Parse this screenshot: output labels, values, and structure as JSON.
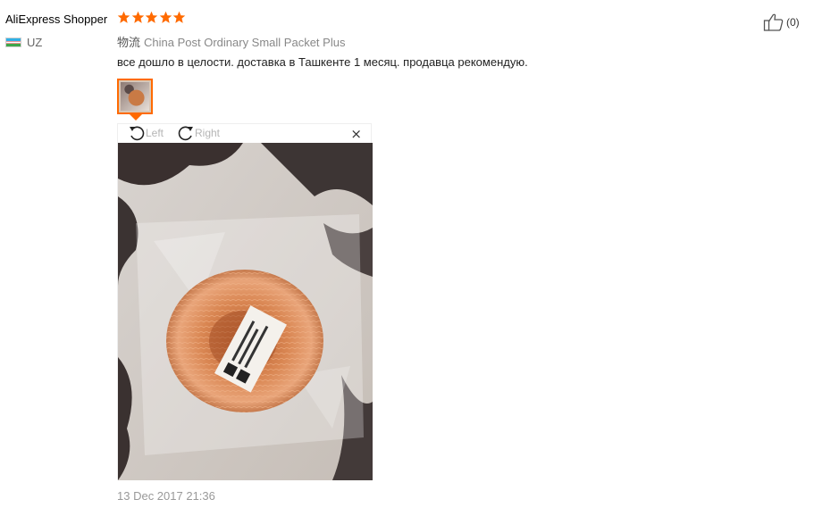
{
  "user": {
    "name": "AliExpress Shopper",
    "country": "UZ"
  },
  "review": {
    "rating": 5,
    "star_color": "#ff6a00",
    "shipping_label": "物流",
    "shipping_method": "China Post Ordinary Small Packet Plus",
    "text": "все дошло в целости. доставка в Ташкенте 1 месяц. продавца рекомендую.",
    "date": "13 Dec 2017 21:36"
  },
  "viewer": {
    "rotate_left_label": "Left",
    "rotate_right_label": "Right",
    "close_glyph": "×"
  },
  "helpful": {
    "count": "(0)",
    "icon": "thumbs-up-icon"
  },
  "colors": {
    "accent": "#ff6a00"
  }
}
